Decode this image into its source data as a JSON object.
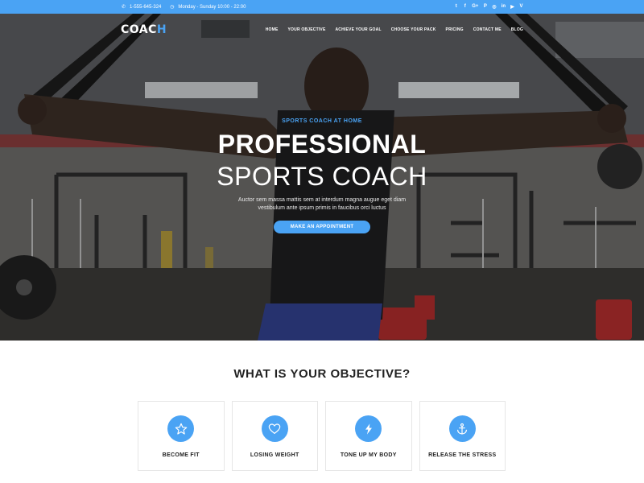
{
  "topbar": {
    "phone": "1-555-645-324",
    "hours": "Monday - Sunday 10:00 - 22:00",
    "social": [
      "twitter",
      "facebook",
      "google-plus",
      "pinterest",
      "instagram",
      "linkedin",
      "youtube",
      "vimeo"
    ],
    "social_glyphs": [
      "t",
      "f",
      "G+",
      "P",
      "◎",
      "in",
      "▶",
      "V"
    ]
  },
  "nav": {
    "logo_main": "COAC",
    "logo_accent": "H",
    "items": [
      "HOME",
      "YOUR OBJECTIVE",
      "ACHIEVE YOUR GOAL",
      "CHOOSE YOUR PACK",
      "PRICING",
      "CONTACT ME",
      "BLOG"
    ]
  },
  "hero": {
    "kicker": "SPORTS COACH AT HOME",
    "title_bold": "PROFESSIONAL",
    "title_light": "SPORTS COACH",
    "description_line1": "Auctor sem massa mattis sem at interdum magna augue eget diam",
    "description_line2": "vestibulum ante ipsum primis in faucibus orci luctus",
    "cta": "MAKE AN APPOINTMENT"
  },
  "objectives": {
    "title": "WHAT IS YOUR OBJECTIVE?",
    "cards": [
      {
        "label": "BECOME FIT",
        "icon": "star-icon"
      },
      {
        "label": "LOSING WEIGHT",
        "icon": "heart-icon"
      },
      {
        "label": "TONE UP MY BODY",
        "icon": "lightning-icon"
      },
      {
        "label": "RELEASE THE STRESS",
        "icon": "anchor-icon"
      }
    ]
  },
  "colors": {
    "accent": "#4aa3f4",
    "text_dark": "#222222"
  }
}
